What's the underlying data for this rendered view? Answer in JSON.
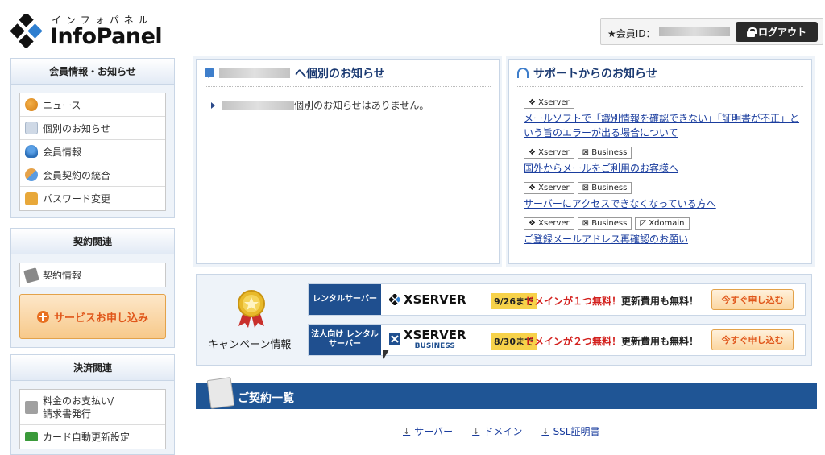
{
  "header": {
    "logo_kana": "インフォパネル",
    "logo_name": "InfoPanel",
    "member_label": "★会員ID：",
    "logout_label": "ログアウト"
  },
  "sidebar": {
    "section1": {
      "title": "会員情報・お知らせ",
      "items": [
        {
          "label": "ニュース",
          "icon": "news-icon"
        },
        {
          "label": "個別のお知らせ",
          "icon": "notice-icon"
        },
        {
          "label": "会員情報",
          "icon": "member-icon"
        },
        {
          "label": "会員契約の統合",
          "icon": "merge-icon"
        },
        {
          "label": "パスワード変更",
          "icon": "lock-icon"
        }
      ]
    },
    "section2": {
      "title": "契約関連",
      "items": [
        {
          "label": "契約情報",
          "icon": "contract-icon"
        }
      ],
      "apply_label": "サービスお申し込み"
    },
    "section3": {
      "title": "決済関連",
      "items": [
        {
          "label1": "料金のお支払い/",
          "label2": "請求書発行",
          "icon": "payment-icon"
        },
        {
          "label": "カード自動更新設定",
          "icon": "card-icon"
        }
      ]
    }
  },
  "personal_notice": {
    "title_suffix": "へ個別のお知らせ",
    "message_suffix": "個別のお知らせはありません。"
  },
  "support": {
    "title": "サポートからのお知らせ",
    "items": [
      {
        "tags": [
          "Xserver"
        ],
        "link": "メールソフトで「識別情報を確認できない」「証明書が不正」という旨のエラーが出る場合について"
      },
      {
        "tags": [
          "Xserver",
          "Business"
        ],
        "link": "国外からメールをご利用のお客様へ"
      },
      {
        "tags": [
          "Xserver",
          "Business"
        ],
        "link": "サーバーにアクセスできなくなっている方へ"
      },
      {
        "tags": [
          "Xserver",
          "Business",
          "Xdomain"
        ],
        "link": "ご登録メールアドレス再確認のお願い"
      }
    ]
  },
  "campaign": {
    "label": "キャンペーン情報",
    "rows": [
      {
        "category": "レンタルサーバー",
        "brand": "XSERVER",
        "brand_sub": "",
        "date": "9/26まで",
        "promo_red": "ドメインが１つ無料！",
        "promo_black": "更新費用も無料！",
        "cta": "今すぐ申し込む"
      },
      {
        "category": "法人向け レンタルサーバー",
        "brand": "XSERVER",
        "brand_sub": "BUSINESS",
        "date": "8/30まで",
        "promo_red": "ドメインが２つ無料！",
        "promo_black": "更新費用も無料！",
        "cta": "今すぐ申し込む"
      }
    ]
  },
  "contracts": {
    "title": "ご契約一覧",
    "links": [
      "サーバー",
      "ドメイン",
      "SSL証明書"
    ]
  }
}
